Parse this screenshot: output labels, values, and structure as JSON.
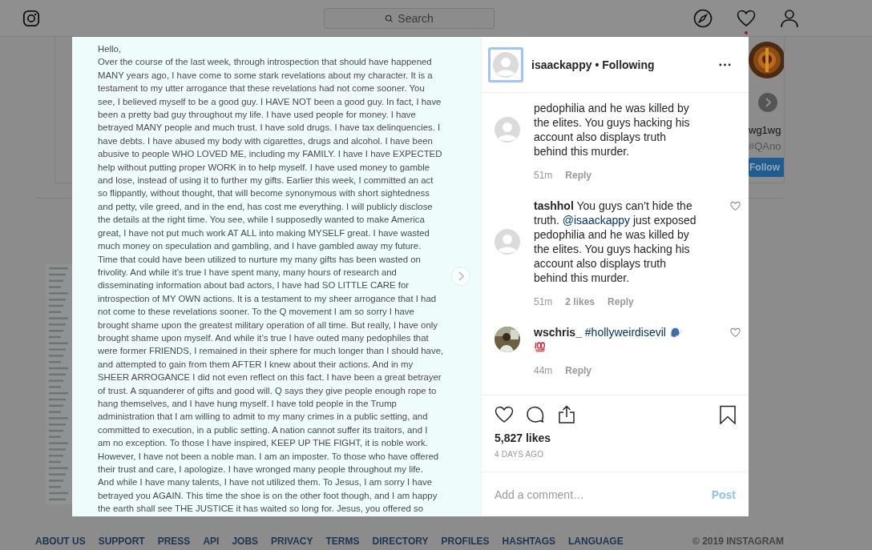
{
  "top_bar": {
    "search": {
      "placeholder": "Search"
    },
    "notification_dot": true
  },
  "background": {
    "suggestion": {
      "username": "wg1wg",
      "subtitle": "#QAno",
      "follow_button": "Follow"
    }
  },
  "post": {
    "letter": {
      "greeting": "Hello,",
      "lines": [
        "Over the course of the last week, through introspection that should have happened",
        "MANY years ago, I have come to some stark revelations about my character. It is a",
        "testament to my utter arrogance that these revelations had not come sooner. You",
        "see, I believed myself to be a good guy. I HAVE NOT been a good guy. In fact, I have",
        "been a pretty bad guy throughout my life. I have used people for money. I have",
        "betrayed MANY people and much trust. I have sold drugs. I have tax delinquencies. I",
        "have debts. I have abused my body with cigarettes, drugs and alcohol. I have been",
        "abusive to people WHO LOVED ME, including my FAMILY. I have I have EXPECTED",
        "help without putting proper WORK in to help myself. I have used money to gamble",
        "and lose, instead of using it to further my gifts. Earlier this week, I committed an act",
        "so flippantly, without thought, that will become synonymous with short sightedness",
        "and petty, vile greed, and in the end, has cost me everything. I will publicly disclose",
        "the details at the right time. You see, while I supposedly wanted to make America",
        "great, I have not put much work AT ALL into making MYSELF great. I have wasted",
        "much money on speculation and gambling, and I have gambled away my future.",
        "Time that could have been utilized to nurture my many gifts has been wasted on",
        "frivolity. And while it’s true I have spent many, many hours of research and",
        "disseminating information about bad actors, I have had SO LITTLE CARE for",
        "introspection of MY OWN actions. It is a testament to my sheer arrogance that I had",
        "not come to these revelations sooner. To the Q movement I am so sorry I have",
        "brought shame upon the greatest military operation of all time. But really, I have only",
        "brought shame upon myself. And while it’s true I have outed many pedophiles that",
        "were former FRIENDS, I remained in their sphere for much longer than I should have,",
        "and attempted to gain from them AFTER I knew about their actions. And in my",
        "SHEER ARROGANCE I did not even reflect on this fact. I have been a great betrayer",
        "of trust. A squanderer of gifts and good will. Q says they give people enough rope to",
        "hang themselves, and I have hung myself. I have told people in the Trump",
        "administration that I am willing to admit to my many crimes in a public setting, and",
        "committed to execution, in a public setting. A nation cannot suffer its traitors, and I",
        "am no exception. To those I have inspired, KEEP UP THE FIGHT, it is noble work.",
        "However, I have not been a noble man. I am an imposter. To those who have offered",
        "their trust and care, I apologize. I have wronged many people throughout my life.",
        "And while I have many talents, I have not utilized them. To Jesus, I am sorry I have",
        "betrayed you AGAIN. This time the shoe is on the other foot though, and I am happy",
        "the earth shall see THE JUSTICE it has waited so long for. Jesus, you offered so"
      ]
    },
    "header": {
      "username": "isaackappy",
      "separator": "•",
      "status": "Following"
    },
    "comments": [
      {
        "avatar_photo": false,
        "segments": [
          {
            "kind": "text",
            "text": "pedophilia and he was killed by the elites. You guys hacking his account also displays truth behind this murder."
          }
        ],
        "time": "51m",
        "reply": "Reply"
      },
      {
        "avatar_photo": false,
        "like_button": true,
        "segments": [
          {
            "kind": "user",
            "text": "tashhol"
          },
          {
            "kind": "text",
            "text": "You guys can’t hide the truth."
          },
          {
            "kind": "mention",
            "text": "@isaackappy"
          },
          {
            "kind": "text",
            "text": "just exposed pedophilia and he was killed by the elites. You guys hacking his account also displays truth behind this murder."
          }
        ],
        "time": "51m",
        "likes": "2 likes",
        "reply": "Reply"
      },
      {
        "avatar_photo": true,
        "like_button": true,
        "segments": [
          {
            "kind": "user",
            "text": "wschris_"
          },
          {
            "kind": "mention",
            "text": "#hollyweirdisevil"
          },
          {
            "kind": "speaking-head"
          },
          {
            "kind": "hundred"
          }
        ],
        "time": "44m",
        "reply": "Reply"
      }
    ],
    "likes": "5,827 likes",
    "time": "4 DAYS AGO",
    "comment_field": {
      "placeholder": "Add a comment…"
    },
    "post_button": {
      "label": "Post",
      "disabled": true
    }
  },
  "footer": {
    "links": [
      "ABOUT US",
      "SUPPORT",
      "PRESS",
      "API",
      "JOBS",
      "PRIVACY",
      "TERMS",
      "DIRECTORY",
      "PROFILES",
      "HASHTAGS",
      "LANGUAGE"
    ],
    "copyright": "© 2019 INSTAGRAM"
  }
}
